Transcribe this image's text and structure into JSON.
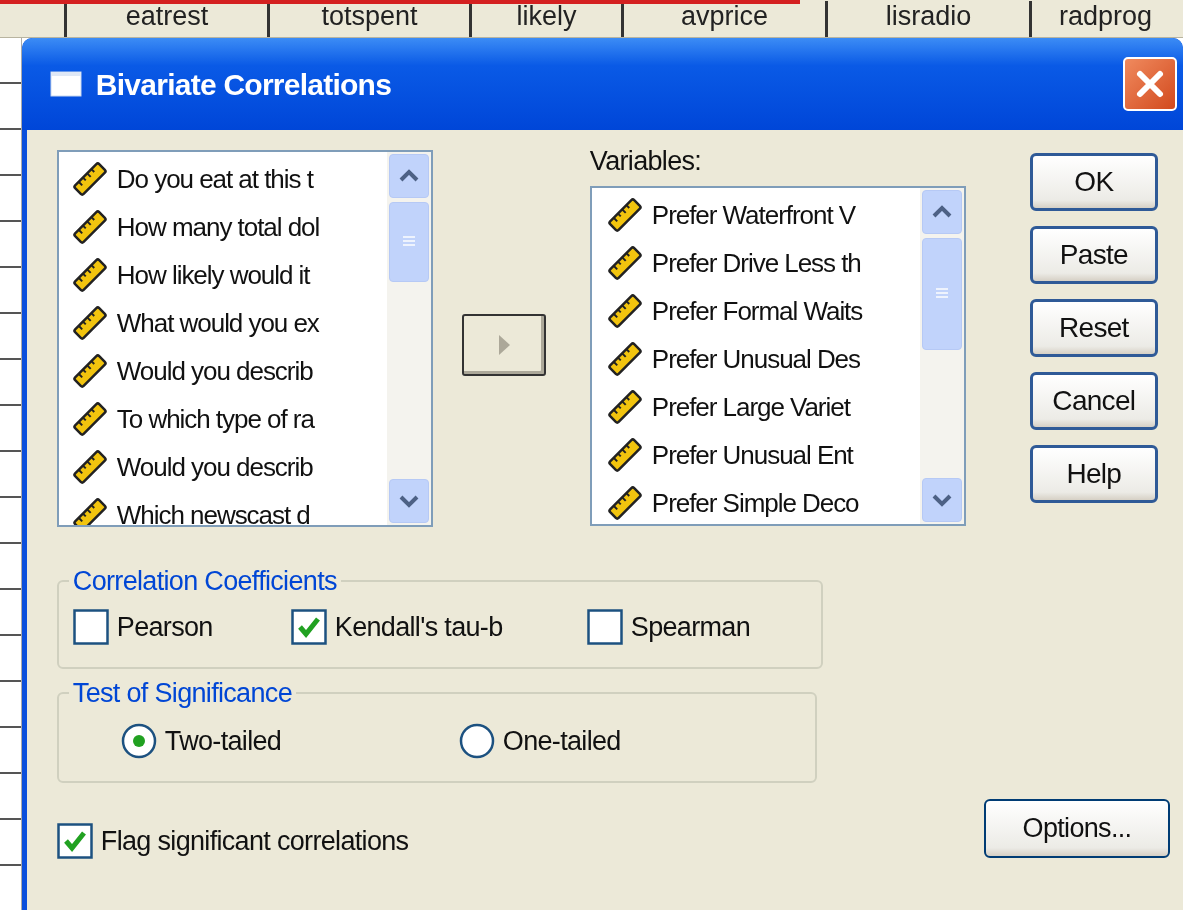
{
  "spreadsheet_columns": [
    "eatrest",
    "totspent",
    "likely",
    "avprice",
    "lisradio",
    "radprog"
  ],
  "window": {
    "title": "Bivariate Correlations"
  },
  "source_list": {
    "items": [
      {
        "label": "Do you eat at this t"
      },
      {
        "label": "How many total dol"
      },
      {
        "label": "How likely would it"
      },
      {
        "label": "What would you ex"
      },
      {
        "label": "Would you describ"
      },
      {
        "label": "To which type of ra"
      },
      {
        "label": "Would you describ"
      },
      {
        "label": "Which newscast d"
      }
    ]
  },
  "move_button": {
    "disabled": true
  },
  "variables": {
    "label": "Variables:",
    "items": [
      {
        "label": "Prefer Waterfront V"
      },
      {
        "label": "Prefer Drive Less th"
      },
      {
        "label": "Prefer Formal Waits"
      },
      {
        "label": "Prefer Unusual Des"
      },
      {
        "label": "Prefer Large Variet"
      },
      {
        "label": "Prefer Unusual Ent"
      },
      {
        "label": "Prefer Simple Deco"
      }
    ]
  },
  "buttons": [
    "OK",
    "Paste",
    "Reset",
    "Cancel",
    "Help"
  ],
  "correlation_coefficients": {
    "title": "Correlation Coefficients",
    "options": [
      {
        "label": "Pearson",
        "checked": false
      },
      {
        "label": "Kendall's tau-b",
        "checked": true
      },
      {
        "label": "Spearman",
        "checked": false
      }
    ]
  },
  "test_of_significance": {
    "title": "Test of Significance",
    "options": [
      {
        "label": "Two-tailed",
        "selected": true
      },
      {
        "label": "One-tailed",
        "selected": false
      }
    ]
  },
  "flag_significant": {
    "label": "Flag significant correlations",
    "checked": true
  },
  "options_button": "Options..."
}
